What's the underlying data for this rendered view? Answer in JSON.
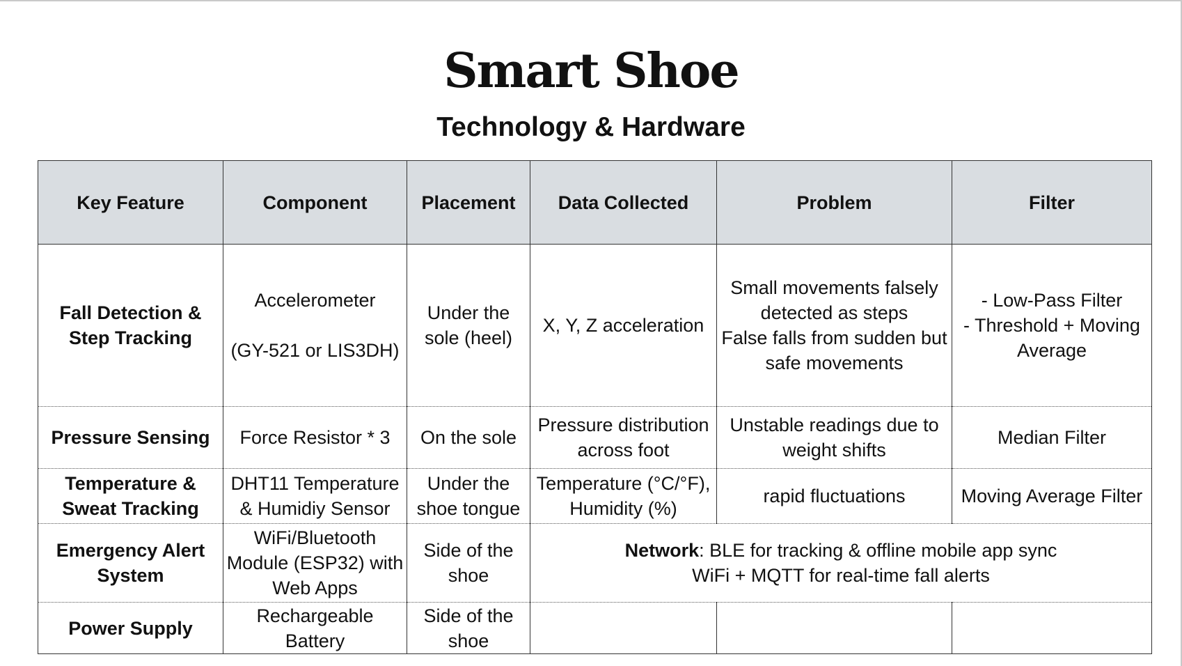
{
  "title": "Smart Shoe",
  "subtitle": "Technology & Hardware",
  "columns": [
    "Key Feature",
    "Component",
    "Placement",
    "Data Collected",
    "Problem",
    "Filter"
  ],
  "rows": [
    {
      "feature": "Fall Detection & Step Tracking",
      "component_line1": "Accelerometer",
      "component_line2": "(GY-521 or LIS3DH)",
      "placement": "Under the sole (heel)",
      "data": "X, Y, Z acceleration",
      "problem_line1": "Small movements falsely detected as steps",
      "problem_line2": "False falls from sudden but safe movements",
      "filter_line1": "- Low-Pass Filter",
      "filter_line2": "- Threshold + Moving Average"
    },
    {
      "feature": "Pressure Sensing",
      "component": "Force Resistor * 3",
      "placement": "On the sole",
      "data": "Pressure distribution across foot",
      "problem": "Unstable readings due to weight shifts",
      "filter": "Median Filter"
    },
    {
      "feature": "Temperature & Sweat Tracking",
      "component": "DHT11 Temperature & Humidiy Sensor",
      "placement": "Under the shoe tongue",
      "data": "Temperature (°C/°F), Humidity (%)",
      "problem": "rapid fluctuations",
      "filter": "Moving Average Filter"
    },
    {
      "feature": "Emergency Alert System",
      "component": "WiFi/Bluetooth Module (ESP32) with Web Apps",
      "placement": "Side of the shoe",
      "network_label": "Network",
      "network_line1": ": BLE for tracking & offline mobile app sync",
      "network_line2": "WiFi + MQTT for real-time fall alerts"
    },
    {
      "feature": "Power Supply",
      "component": "Rechargeable Battery",
      "placement": "Side of the shoe",
      "data": "",
      "problem": "",
      "filter": ""
    }
  ]
}
